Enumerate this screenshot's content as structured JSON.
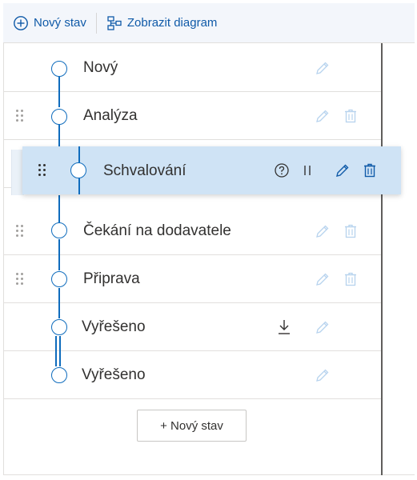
{
  "toolbar": {
    "new_state_label": "Nový stav",
    "show_diagram_label": "Zobrazit diagram"
  },
  "states": [
    {
      "label": "Nový",
      "draggable": false,
      "deletable": false
    },
    {
      "label": "Analýza",
      "draggable": true,
      "deletable": true
    },
    {
      "label": "Schvalování",
      "draggable": true,
      "deletable": true,
      "being_dragged": true
    },
    {
      "label": "Čekání na dodavatele",
      "draggable": true,
      "deletable": true
    },
    {
      "label": "Připrava",
      "draggable": true,
      "deletable": true
    },
    {
      "label": "Vyřešeno",
      "draggable": false,
      "deletable": false,
      "has_download": true
    },
    {
      "label": "Vyřešeno",
      "draggable": false,
      "deletable": false
    }
  ],
  "add_button_label": "+ Nový stav",
  "colors": {
    "accent": "#0f6cbd",
    "toolbar_bg": "#f3f6fb",
    "drag_highlight": "#cfe3f5",
    "disabled_icon": "#b7d3ee"
  },
  "icons": {
    "new_state": "plus-circle-icon",
    "diagram": "flowchart-icon",
    "edit": "pencil-icon",
    "delete": "trash-icon",
    "help": "question-circle-icon",
    "pause": "pause-icon",
    "download": "download-icon",
    "drag": "drag-handle-icon"
  }
}
